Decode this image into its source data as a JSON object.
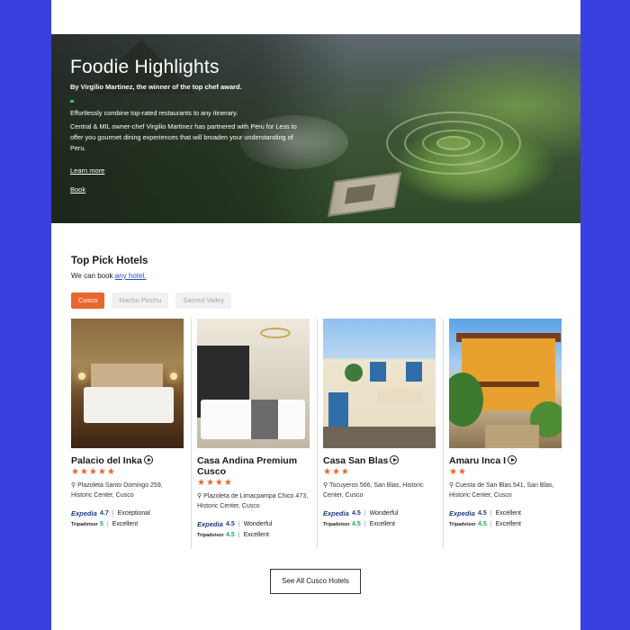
{
  "hero": {
    "title": "Foodie Highlights",
    "byline": "By Virgilio Martinez, the winner of the top chef award.",
    "intro": "Effortlessly combine top-rated restaurants to any itinerary.",
    "body": "Central & MIL owner-chef Virgilio Martinez has partnered with Peru for Less to offer you gourmet dining experiences that will broaden your understanding of Peru.",
    "learn_more": "Learn more",
    "book": "Book"
  },
  "top_picks": {
    "title": "Top Pick Hotels",
    "subtitle_prefix": "We can book",
    "subtitle_link": "any hotel.",
    "tabs": [
      {
        "label": "Cusco",
        "active": true
      },
      {
        "label": "Machu Picchu",
        "active": false
      },
      {
        "label": "Sacred Valley",
        "active": false
      }
    ],
    "hotels": [
      {
        "name": "Palacio del Inka",
        "stars": "★★★★★",
        "address": "Plazoleta Santo Domingo 259, Historic Center, Cusco",
        "expedia_label": "Expedia",
        "expedia_score": "4.7",
        "expedia_text": "Exceptional",
        "trip_label": "Tripadvisor",
        "trip_score": "5",
        "trip_text": "Excellent"
      },
      {
        "name": "Casa Andina Premium Cusco",
        "stars": "★★★★",
        "address": "Plazoleta de Limacpampa Chico 473, Historic Center, Cusco",
        "expedia_label": "Expedia",
        "expedia_score": "4.5",
        "expedia_text": "Wonderful",
        "trip_label": "Tripadvisor",
        "trip_score": "4.5",
        "trip_text": "Excellent"
      },
      {
        "name": "Casa San Blas",
        "stars": "★★★",
        "address": "Tocuyeros 566, San Blas, Historic Center, Cusco",
        "expedia_label": "Expedia",
        "expedia_score": "4.5",
        "expedia_text": "Wonderful",
        "trip_label": "Tripadvisor",
        "trip_score": "4.5",
        "trip_text": "Excellent"
      },
      {
        "name": "Amaru Inca I",
        "stars": "★★",
        "address": "Cuesta de San Blas 541, San Blas, Historic Center, Cusco",
        "expedia_label": "Expedia",
        "expedia_score": "4.5",
        "expedia_text": "Excellent",
        "trip_label": "Tripadvisor",
        "trip_score": "4.5",
        "trip_text": "Excellent"
      }
    ],
    "see_all": "See All Cusco Hotels"
  },
  "colors": {
    "page_background": "#3a3fe0",
    "accent_orange": "#e8672e",
    "link_blue": "#1f4fc8",
    "expedia_blue": "#1b3a8a",
    "tripadvisor_green": "#19a86a"
  },
  "icons": [
    "play-icon",
    "map-pin-icon",
    "star-icon"
  ]
}
